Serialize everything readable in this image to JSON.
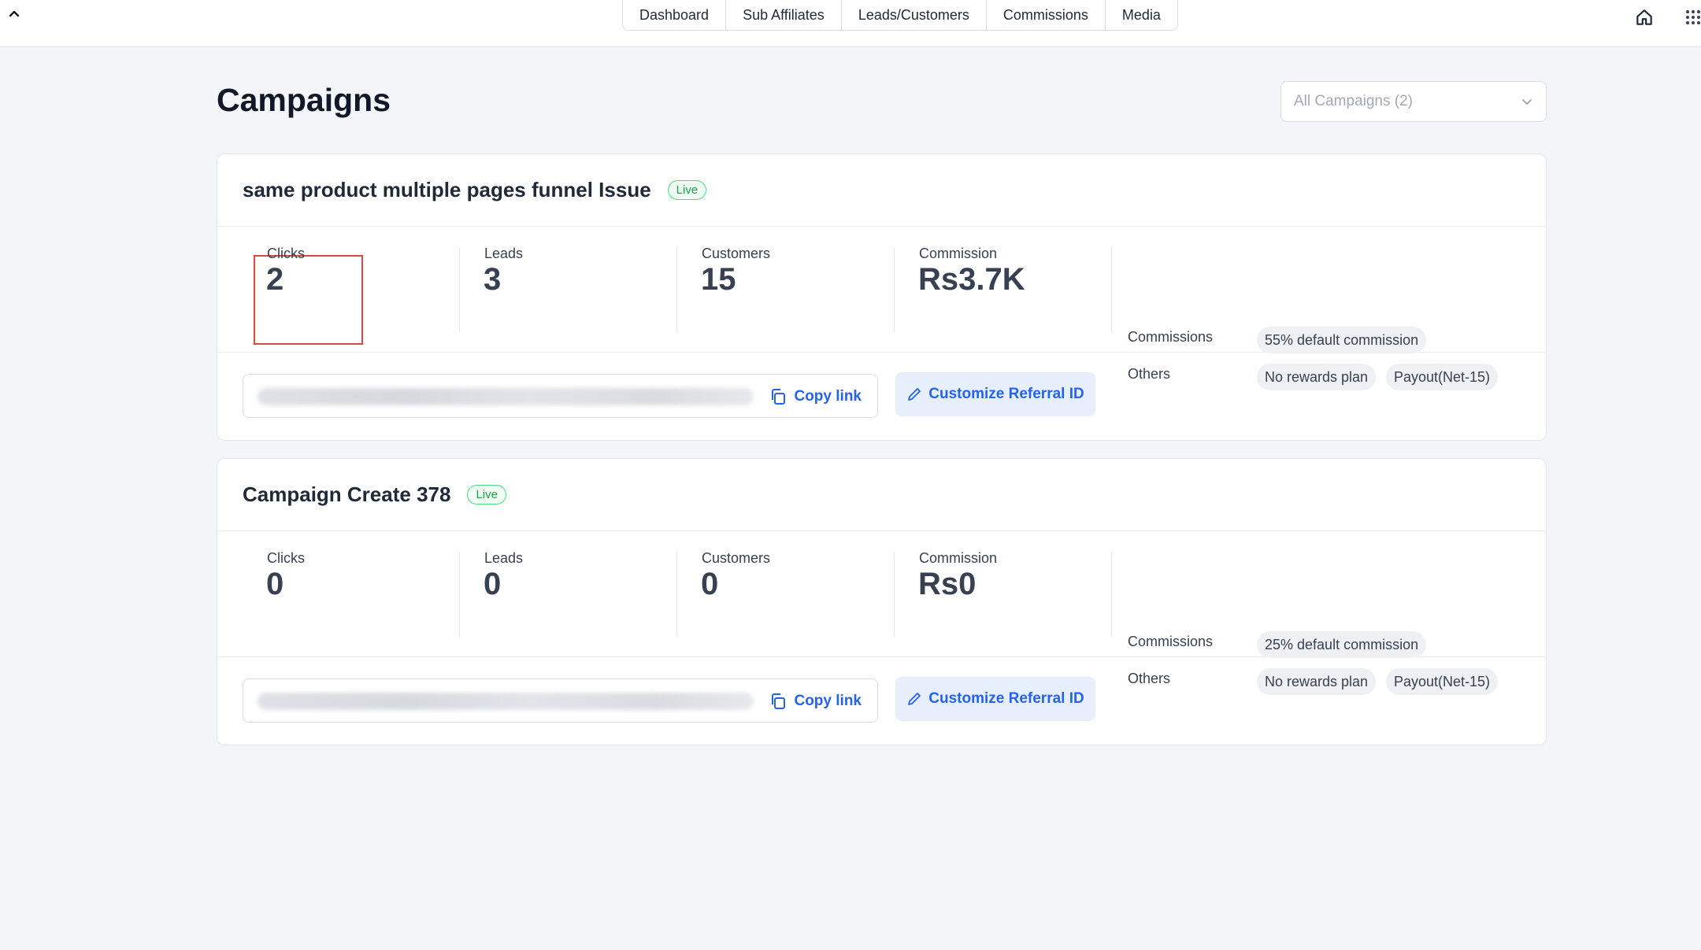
{
  "nav": {
    "tabs": [
      {
        "label": "Dashboard"
      },
      {
        "label": "Sub Affiliates"
      },
      {
        "label": "Leads/Customers"
      },
      {
        "label": "Commissions"
      },
      {
        "label": "Media"
      }
    ]
  },
  "page": {
    "title": "Campaigns",
    "filter_placeholder": "All Campaigns (2)"
  },
  "campaigns": [
    {
      "name": "same product multiple pages funnel Issue",
      "status": "Live",
      "clicks_label": "Clicks",
      "clicks": "2",
      "leads_label": "Leads",
      "leads": "3",
      "customers_label": "Customers",
      "customers": "15",
      "commission_label": "Commission",
      "commission": "Rs3.7K",
      "commissions_label": "Commissions",
      "commission_pill": "55% default commission",
      "others_label": "Others",
      "rewards_pill": "No rewards plan",
      "payout_pill": "Payout(Net-15)",
      "copy_label": "Copy link",
      "customize_label": "Customize Referral ID"
    },
    {
      "name": "Campaign Create 378",
      "status": "Live",
      "clicks_label": "Clicks",
      "clicks": "0",
      "leads_label": "Leads",
      "leads": "0",
      "customers_label": "Customers",
      "customers": "0",
      "commission_label": "Commission",
      "commission": "Rs0",
      "commissions_label": "Commissions",
      "commission_pill": "25% default commission",
      "others_label": "Others",
      "rewards_pill": "No rewards plan",
      "payout_pill": "Payout(Net-15)",
      "copy_label": "Copy link",
      "customize_label": "Customize Referral ID"
    }
  ],
  "colors": {
    "accent": "#2563eb",
    "live": "#16a34a",
    "highlight": "#e04a3b"
  },
  "icons": [
    "chevron-up-icon",
    "home-icon",
    "apps-grid-icon",
    "chevron-down-icon",
    "copy-icon",
    "pencil-icon"
  ]
}
